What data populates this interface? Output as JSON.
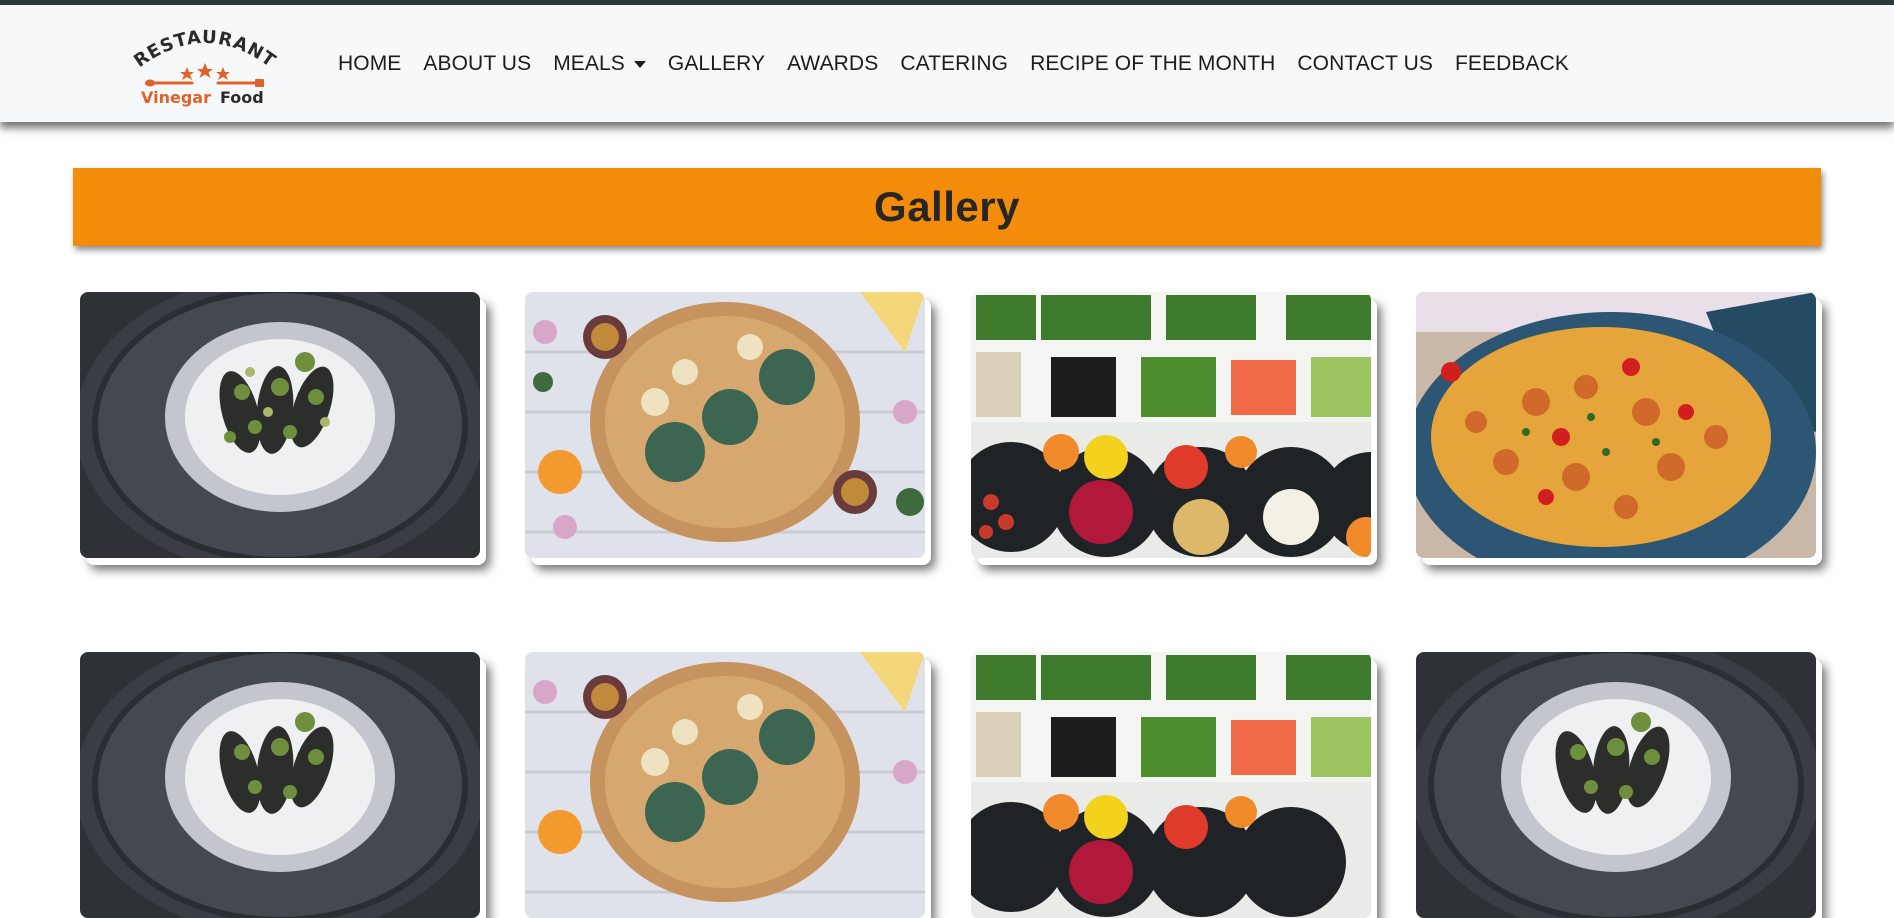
{
  "brand": {
    "logo_alt": "Vinegar Food Restaurant logo",
    "arc_text": "RESTAURANT",
    "name_part1": "Vinegar",
    "name_part2": "Food",
    "colors": {
      "accent": "#e0622a",
      "dark": "#2b2b2b"
    }
  },
  "nav": {
    "items": [
      {
        "label": "HOME"
      },
      {
        "label": "ABOUT US"
      },
      {
        "label": "MEALS",
        "dropdown": true
      },
      {
        "label": "GALLERY"
      },
      {
        "label": "AWARDS"
      },
      {
        "label": "CATERING"
      },
      {
        "label": "RECIPE OF THE MONTH"
      },
      {
        "label": "CONTACT US"
      },
      {
        "label": "FEEDBACK"
      }
    ]
  },
  "page": {
    "title": "Gallery",
    "banner_color": "#f28c0a"
  },
  "gallery": {
    "items": [
      {
        "image": "mussels-on-salt-plate"
      },
      {
        "image": "pastries-on-wooden-board"
      },
      {
        "image": "vegetable-salad-bar"
      },
      {
        "image": "seafood-paella-pot"
      },
      {
        "image": "mussels-on-salt-plate"
      },
      {
        "image": "pastries-on-wooden-board"
      },
      {
        "image": "vegetable-salad-bar"
      },
      {
        "image": "mussels-on-salt-plate"
      }
    ]
  }
}
